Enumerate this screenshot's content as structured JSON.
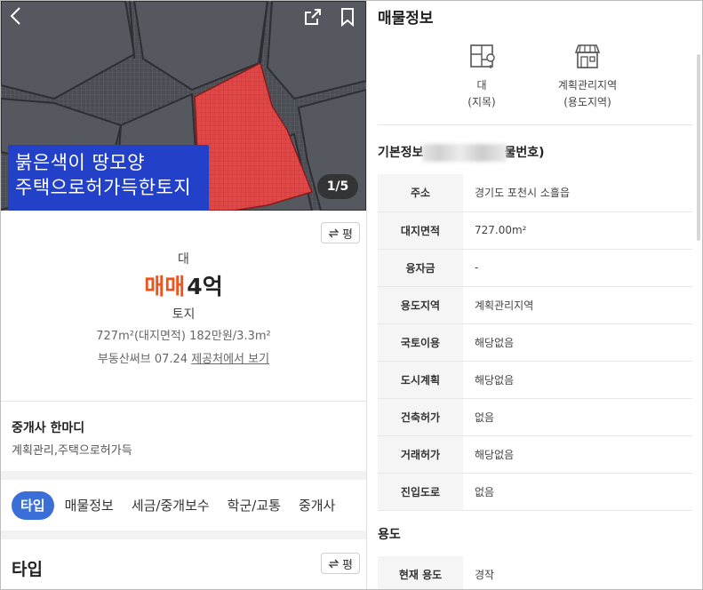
{
  "gallery": {
    "caption_line1": "붉은색이  땅모양",
    "caption_line2": "주택으로허가득한토지",
    "page_counter": "1/5",
    "icons": {
      "back": "chevron-left-icon",
      "share": "share-icon",
      "bookmark": "bookmark-icon"
    }
  },
  "summary": {
    "unit_toggle": "평",
    "land_category": "대",
    "deal_type": "매매",
    "price": "4억",
    "property_type": "토지",
    "area_text": "727m²(대지면적)  182만원/3.3m²",
    "source": "부동산써브 07.24",
    "source_link": "제공처에서 보기"
  },
  "agent_comment": {
    "title": "중개사 한마디",
    "text": "계획관리,주택으로허가득"
  },
  "tabs": [
    {
      "label": "타입",
      "active": true
    },
    {
      "label": "매물정보",
      "active": false
    },
    {
      "label": "세금/중개보수",
      "active": false
    },
    {
      "label": "학군/교통",
      "active": false
    },
    {
      "label": "중개사",
      "active": false
    }
  ],
  "type_section": {
    "title": "타입",
    "unit_toggle": "평"
  },
  "property_info": {
    "title": "매물정보",
    "features": [
      {
        "icon": "land-map-icon",
        "value": "대",
        "caption": "(지목)"
      },
      {
        "icon": "store-icon",
        "value": "계획관리지역",
        "caption": "(용도지역)"
      }
    ],
    "basic_title_start": "기본정보",
    "basic_title_end": "물번호)",
    "rows": [
      {
        "key": "주소",
        "value": "경기도 포천시 소흘읍"
      },
      {
        "key": "대지면적",
        "value": "727.00m²"
      },
      {
        "key": "융자금",
        "value": "-"
      },
      {
        "key": "용도지역",
        "value": "계획관리지역"
      },
      {
        "key": "국토이용",
        "value": "해당없음"
      },
      {
        "key": "도시계획",
        "value": "해당없음"
      },
      {
        "key": "건축허가",
        "value": "없음"
      },
      {
        "key": "거래허가",
        "value": "해당없음"
      },
      {
        "key": "진입도로",
        "value": "없음"
      }
    ],
    "use_title": "용도",
    "use_rows": [
      {
        "key": "현재 용도",
        "value": "경작"
      }
    ]
  },
  "colors": {
    "deal_accent": "#f0541e",
    "tab_active": "#3a6fd8",
    "caption_bg": "#2240c8",
    "parcel_red": "#e23a3a"
  }
}
